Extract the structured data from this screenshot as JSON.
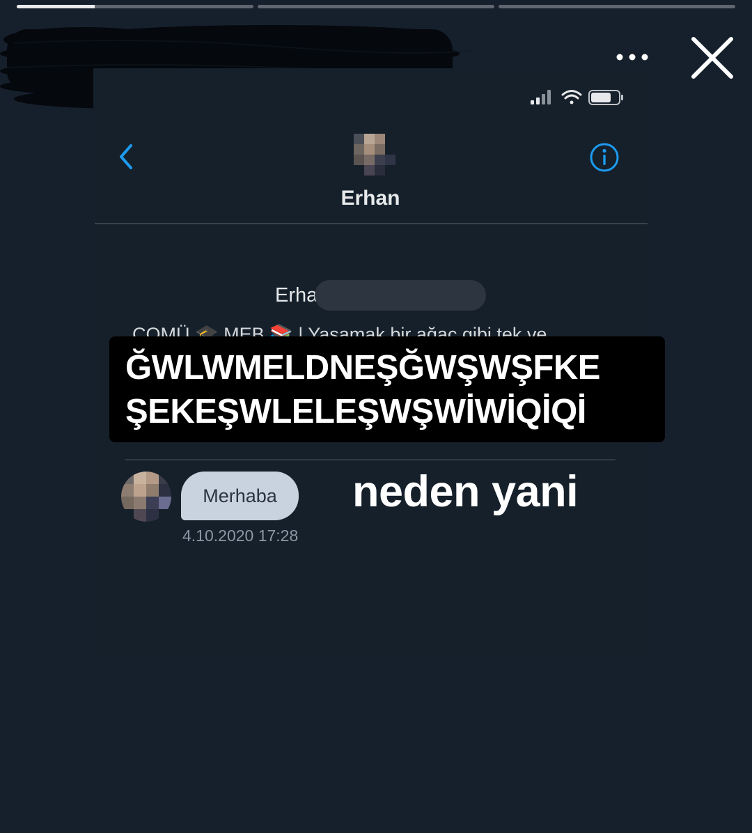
{
  "story": {
    "progress_segments": [
      0.33,
      0,
      0
    ],
    "more_icon": "more-horizontal-icon",
    "close_icon": "close-icon"
  },
  "status_bar": {
    "icons": [
      "cellular-signal-icon",
      "wifi-icon",
      "battery-icon"
    ]
  },
  "chat_header": {
    "back_icon": "chevron-left-icon",
    "info_icon": "info-circle-icon",
    "name": "Erhan"
  },
  "profile": {
    "name_visible": "Erha",
    "bio": "ÇOMÜ 🎓 MEB 📚 | Yaşamak bir ağaç gibi tek ve"
  },
  "caption": {
    "line1": "ĞWLWMELDNEŞĞWŞWŞFKE",
    "line2": "ŞEKEŞWLELEŞWŞWİWİQİQİ"
  },
  "message": {
    "text": "Merhaba",
    "timestamp": "4.10.2020 17:28"
  },
  "overlay": {
    "text": "neden yani"
  }
}
